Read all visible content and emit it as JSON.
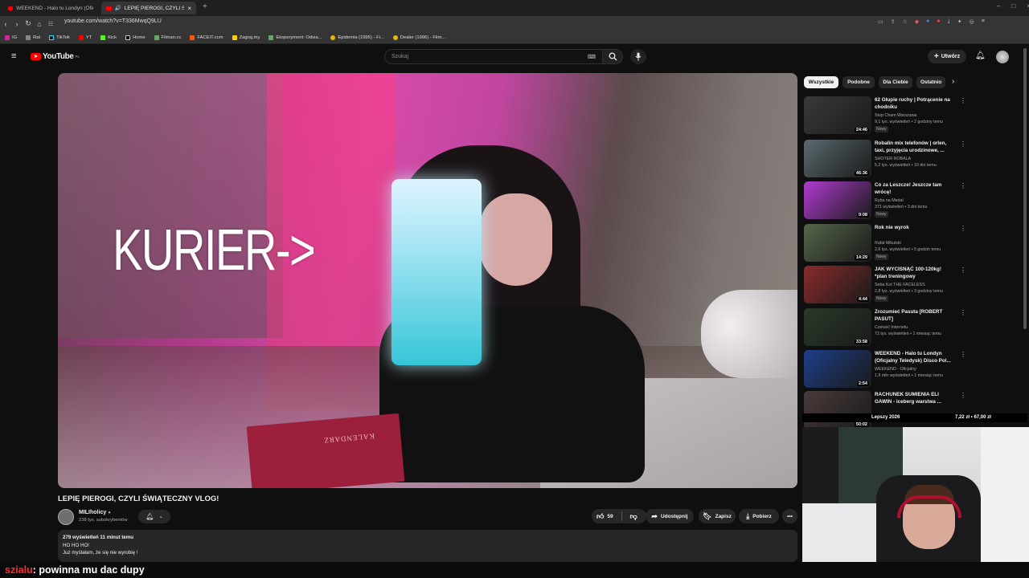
{
  "browser": {
    "tabs": [
      {
        "label": "WEEKEND - Halo tu Londyn (Oficjaln"
      },
      {
        "label": "LEPIĘ PIEROGI, CZYLI ŚWIĄTE"
      }
    ],
    "url": "youtube.com/watch?v=T336MwqQ9LU",
    "bookmarks": [
      "IG",
      "Rat",
      "TikTok",
      "YT",
      "Kick",
      "Home",
      "Filman.cc",
      "FACEIT.com",
      "Zagraj.my",
      "Eksperyment: Odsia...",
      "Epidemia (1995) - Fi...",
      "Dealer (1996) - Film..."
    ]
  },
  "youtube": {
    "logo": "YouTube",
    "logo_region": "PL",
    "search_placeholder": "Szukaj",
    "create_label": "Utwórz"
  },
  "video": {
    "overlay_text": "KURIER->",
    "book_text": "KALENDARZ",
    "title": "LEPIĘ PIEROGI, CZYLI ŚWIĄTECZNY VLOG!",
    "channel": "MILIholicy",
    "subscribers": "238 tys. subskrybentów",
    "likes": "59",
    "share_label": "Udostępnij",
    "save_label": "Zapisz",
    "download_label": "Pobierz",
    "views_time": "279 wyświetleń  11 minut temu",
    "desc_line1": "HO HO HO!",
    "desc_line2": "Już myślałam, że się nie wyrobię !"
  },
  "sidebar": {
    "chips": [
      "Wszystkie",
      "Podobne",
      "Dla Ciebie",
      "Ostatnio"
    ],
    "items": [
      {
        "title": "62 Głupie ruchy | Potrącenie na chodniku",
        "channel": "Stop Cham Warszawa",
        "meta": "9,1 tys. wyświetleń • 2 godziny temu",
        "badge": "Nowy",
        "duration": "24:46",
        "color": "#3a3a3a"
      },
      {
        "title": "Robalin mix telefonów | orlen, taxi, przyjęcia urodzinowe, ...",
        "channel": "SHOTER ROBALA",
        "meta": "5,2 tys. wyświetleń • 10 dni temu",
        "badge": "",
        "duration": "46:36",
        "color": "#5a6a6f"
      },
      {
        "title": "Co za Leszcze! Jeszcze tam wrócę!",
        "channel": "Ryba na Medal",
        "meta": "371 wyświetleń • 3 dni temu",
        "badge": "Nowy",
        "duration": "9:08",
        "color": "#b13bd1"
      },
      {
        "title": "Rok nie wyrok",
        "channel": "Rafał Mikulski",
        "meta": "2,6 tys. wyświetleń • 5 godzin temu",
        "badge": "Nowy",
        "duration": "14:29",
        "color": "#55664a"
      },
      {
        "title": "JAK WYCISNĄĆ 100-120kg! *plan treningowy",
        "channel": "Seba Kot THE FACELESS",
        "meta": "2,8 tys. wyświetleń • 3 godziny temu",
        "badge": "Nowy",
        "duration": "4:44",
        "color": "#8a2b2b"
      },
      {
        "title": "Zrozumieć Pasuta  [ROBERT PASUT]",
        "channel": "Czeluść Internetu",
        "meta": "72 tys. wyświetleń • 1 miesiąc temu",
        "badge": "",
        "duration": "33:58",
        "color": "#2a3a2a"
      },
      {
        "title": "WEEKEND - Halo tu Londyn (Oficjalny Teledysk) Disco Pol...",
        "channel": "WEEKEND - Oficjalny",
        "meta": "1,9 mln wyświetleń • 1 miesiąc temu",
        "badge": "",
        "duration": "2:54",
        "color": "#1e3f8a"
      },
      {
        "title": "RACHUNEK SUMIENIA ELI GAWIN - iceberg warstwa ...",
        "channel": "",
        "meta": "",
        "badge": "",
        "duration": "50:02",
        "color": "#4a3a3a"
      }
    ]
  },
  "stream": {
    "ticker_left": "Lepszy 2026",
    "ticker_right": "7,22 zł • 67,00 zł",
    "chat_user": "szialu",
    "chat_message": " : powinna mu dac dupy"
  }
}
